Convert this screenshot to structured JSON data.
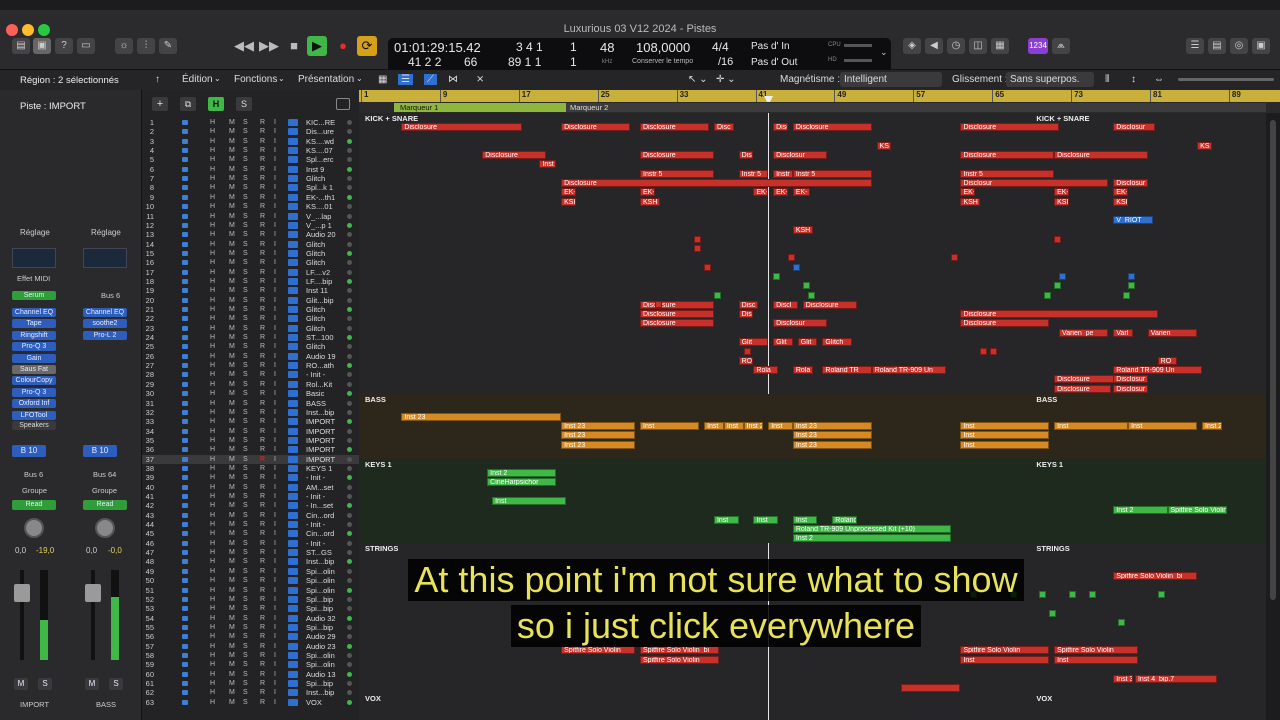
{
  "window": {
    "title": "Luxurious 03 V12 2024 - Pistes"
  },
  "lcd": {
    "smpte": "01:01:29:15.42",
    "bars_top": "3  4  1",
    "sub_top": "1",
    "bars_bot": "41  2  2",
    "ticks_bot": "66",
    "bars_bot2": "89  1  1",
    "sub_bot": "1",
    "beat_div": "48",
    "tempo": "108,0000",
    "tempo_caption": "Conserver le tempo",
    "signature": "4/4",
    "division": "/16",
    "punch_in": "Pas d' In",
    "punch_out": "Pas d' Out",
    "cpu_label": "CPU",
    "hd_label": "HD",
    "khz": "kHz",
    "badge": "1234"
  },
  "controlbar": {
    "edit": "Édition",
    "functions": "Fonctions",
    "presentation": "Présentation",
    "magnetism_label": "Magnétisme :",
    "magnetism_value": "Intelligent",
    "slide_label": "Glissement :",
    "slide_value": "Sans superpos."
  },
  "inspector": {
    "region": "Région : 2 sélectionnés",
    "track": "Piste : IMPORT",
    "setting1": "Réglage",
    "setting2": "Réglage",
    "midi_fx": "Effet MIDI",
    "inst1": "Serum",
    "inst2": "Bus 6",
    "plugins1": [
      "Channel EQ",
      "Tape",
      "Ringshift",
      "Pro-Q 3",
      "Gain",
      "Saus Fat",
      "ColourCopy",
      "Pro-Q 3",
      "Oxford Inf",
      "LFOTool"
    ],
    "plugins2": [
      "Channel EQ",
      "soothe2",
      "Pro-L 2"
    ],
    "speakers": "Speakers",
    "send1": "B 10",
    "send2": "B 10",
    "out1": "Bus 6",
    "out2": "Bus 64",
    "group1": "Groupe",
    "group2": "Groupe",
    "auto1": "Read",
    "auto2": "Read",
    "vol1a": "0,0",
    "vol1b": "-19,0",
    "vol2a": "0,0",
    "vol2b": "-0,0",
    "name1": "IMPORT",
    "name2": "BASS",
    "m": "M",
    "s": "S"
  },
  "header_buttons": {
    "add": "+",
    "h": "H",
    "s": "S"
  },
  "tracks": [
    "KIC...RE",
    "Dis...ure",
    "KS....wd",
    "KS....07",
    "Spl...erc",
    "Inst 9",
    "Glitch",
    "Spl...k 1",
    "EK-...th1",
    "KS....01",
    "V_...lap",
    "V_...p 1",
    "Audio 20",
    "Glitch",
    "Glitch",
    "Glitch",
    "LF....v2",
    "LF....bip",
    "Inst 11",
    "Glit...bip",
    "Glitch",
    "Glitch",
    "Glitch",
    "ST...100",
    "Glitch",
    "Audio 19",
    "RO...ath",
    "- Init -",
    "Rol...Kit",
    "Basic",
    "BASS",
    "Inst...bip",
    "IMPORT",
    "IMPORT",
    "IMPORT",
    "IMPORT",
    "IMPORT",
    "KEYS 1",
    "- Init -",
    "AM...set",
    "- Init -",
    "- In...set",
    "Cin...ord",
    "- Init -",
    "Cin...ord",
    "- Init -",
    "ST...GS",
    "Inst...bip",
    "Spi...olin",
    "Spi...olin",
    "Spi...olin",
    "Spl...bip",
    "Spi...bip",
    "Audio 32",
    "Spi...bip",
    "Audio 29",
    "Audio 23",
    "Spi...olin",
    "Spi...olin",
    "Audio 13",
    "Spi...bip",
    "Inst...bip",
    "VOX"
  ],
  "ruler": [
    "1",
    "9",
    "17",
    "25",
    "33",
    "41",
    "49",
    "57",
    "65",
    "73",
    "81",
    "89"
  ],
  "markers": [
    "Marqueur 1",
    "Marqueur 2"
  ],
  "sections": [
    "KICK + SNARE",
    "KICK + SNARE",
    "BASS",
    "BASS",
    "KEYS 1",
    "KEYS 1",
    "STRINGS",
    "STRINGS",
    "VOX",
    "VOX"
  ],
  "regions": [
    "Disclosure",
    "Disclosure",
    "Disclosure",
    "Disc",
    "Disc",
    "Disclosure",
    "Disclosure",
    "Disclosur",
    "KS",
    "KS",
    "Disclosure",
    "Disclosure",
    "Disc",
    "Disclosur",
    "Disclosure",
    "Disclosure",
    "Disclosure",
    "Inst",
    "Instr 5",
    "Instr 5",
    "Instr",
    "Instr 5",
    "Instr 5",
    "Disclosure",
    "Disclosur",
    "EK-",
    "KSH",
    "EK-",
    "KSH",
    "EK-",
    "EK-",
    "EK-",
    "EK-",
    "KSH",
    "EK-",
    "KSH",
    "EK-",
    "KSH",
    "KSH",
    "V_RIOT",
    "Disclosure",
    "Disc",
    "Discl",
    "Disclosure",
    "Disclosure",
    "Disclosure",
    "Disclosure",
    "Disc",
    "Disclosur",
    "Disclosure",
    "Varien_pe",
    "Varl",
    "Varien",
    "Glit",
    "Glit",
    "Glit",
    "Glitch",
    "RO",
    "RO",
    "Rola",
    "Rola",
    "Roland TR",
    "Roland TR-909 Un",
    "Roland TR-909 Un",
    "Disclosure",
    "Disclosur",
    "Disclosure",
    "Disclosur",
    "Inst 23",
    "Inst 23",
    "Inst 23",
    "Inst 23",
    "Inst",
    "Inst",
    "Inst",
    "Inst 23",
    "Inst 23",
    "Inst 23",
    "Inst 23",
    "Inst",
    "Inst 2",
    "Inst 2",
    "CineHarpsichor",
    "Inst",
    "Inst",
    "Inst",
    "Inst",
    "Roland TR-909 Unprocessed Kit (+10)",
    "Roland TR-909 Unprocessed Kit (+10)",
    "Inst 2",
    "Inst 2",
    "Spitfire Solo Violin",
    "Spitfire Solo Violin_bi",
    "Spitfire Solo Violin",
    "Spitfire Solo Violin_bi",
    "Spitfire Solo Violin",
    "Spitfire Solo Violin",
    "Spitfire Solo Violin",
    "Inst",
    "Inst 3_bip.18",
    "Inst 4_bip.7"
  ],
  "subtitles": [
    "At this point i'm not sure what to show",
    "so i just click everywhere"
  ],
  "colors": {
    "red": "#c8302a",
    "orange": "#d58a24",
    "green": "#3fb847",
    "blue": "#2f6fd1",
    "ruler": "#c8b03a",
    "subtitle": "#e8e25a"
  }
}
